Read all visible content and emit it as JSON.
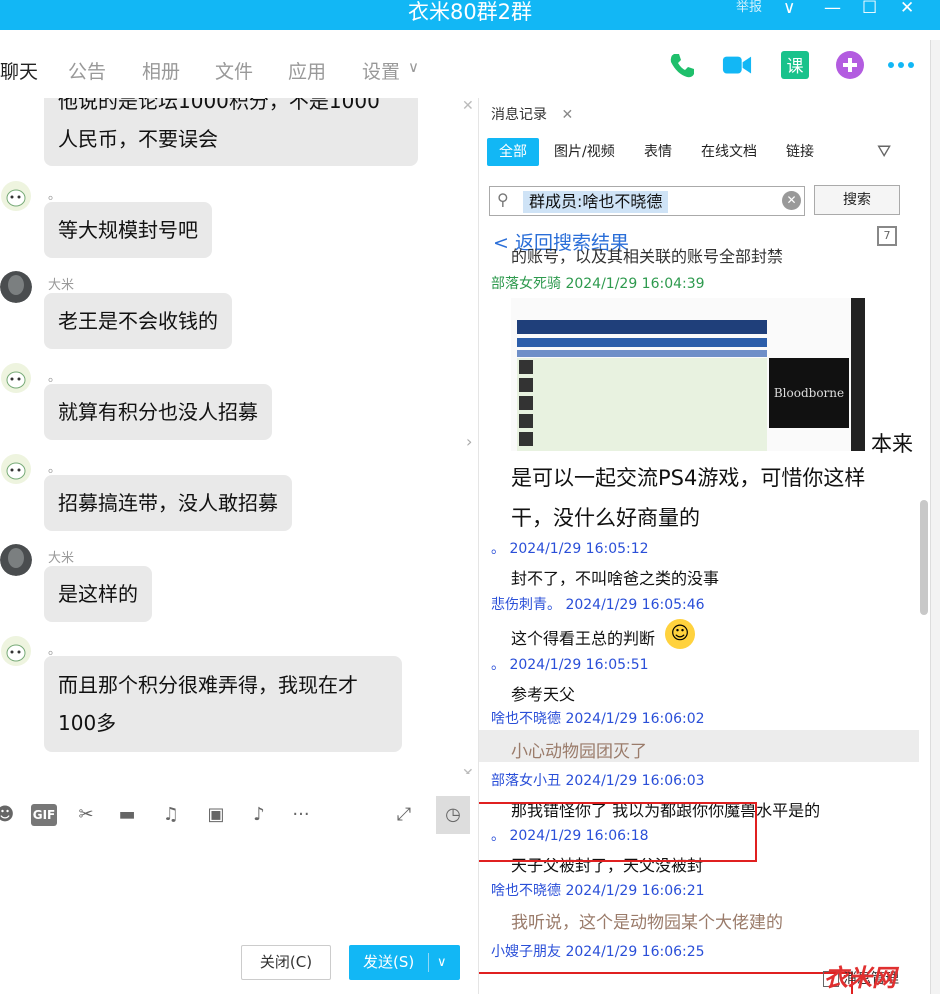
{
  "window": {
    "title": "衣米80群2群",
    "report": "举报"
  },
  "tabs": [
    "聊天",
    "公告",
    "相册",
    "文件",
    "应用",
    "设置"
  ],
  "chat": [
    {
      "nick": "",
      "text_lines": [
        "他说的是论坛1000积分，不是1000",
        "人民币，不要误会"
      ],
      "avatar": "mascot"
    },
    {
      "nick": "。",
      "text_lines": [
        "等大规模封号吧"
      ],
      "avatar": "mascot"
    },
    {
      "nick": "大米",
      "text_lines": [
        "老王是不会收钱的"
      ],
      "avatar": "photo"
    },
    {
      "nick": "。",
      "text_lines": [
        "就算有积分也没人招募"
      ],
      "avatar": "mascot"
    },
    {
      "nick": "。",
      "text_lines": [
        "招募搞连带，没人敢招募"
      ],
      "avatar": "mascot"
    },
    {
      "nick": "大米",
      "text_lines": [
        "是这样的"
      ],
      "avatar": "photo"
    },
    {
      "nick": "。",
      "text_lines": [
        "而且那个积分很难弄得，我现在才",
        "100多"
      ],
      "avatar": "mascot"
    }
  ],
  "composer": {
    "close_label": "关闭(C)",
    "send_label": "发送(S)"
  },
  "history": {
    "tab_label": "消息记录",
    "filters": [
      "全部",
      "图片/视频",
      "表情",
      "在线文档",
      "链接"
    ],
    "search_tag": "群成员:啥也不晓德",
    "search_button": "搜索",
    "back_label": "< 返回搜索结果",
    "partial_top": "的账号，以及其相关联的账号全部封禁",
    "messages": [
      {
        "meta": "部落女死骑 2024/1/29 16:04:39",
        "meta_color": "#2e9a4e",
        "text": ""
      },
      {
        "meta": "。 2024/1/29 16:05:12",
        "meta_color": "#2a4fd8",
        "text": "封不了，不叫啥爸之类的没事"
      },
      {
        "meta": "悲伤刺青。 2024/1/29 16:05:46",
        "meta_color": "#2a4fd8",
        "text": "这个得看王总的判断"
      },
      {
        "meta": "。 2024/1/29 16:05:51",
        "meta_color": "#2a4fd8",
        "text": "参考天父"
      },
      {
        "meta": "啥也不晓德 2024/1/29 16:06:02",
        "meta_color": "#2a4fd8",
        "text": "小心动物园团灭了",
        "highlight": true
      },
      {
        "meta": "部落女小丑 2024/1/29 16:06:03",
        "meta_color": "#2a4fd8",
        "text": "那我错怪你了 我以为都跟你你魔兽水平是的"
      },
      {
        "meta": "。 2024/1/29 16:06:18",
        "meta_color": "#2a4fd8",
        "text": "天子父被封了，天父没被封"
      },
      {
        "meta": "啥也不晓德 2024/1/29 16:06:21",
        "meta_color": "#2a4fd8",
        "text": "我听说，这个是动物园某个大佬建的",
        "highlight": true
      },
      {
        "meta": "小嫂子朋友 2024/1/29 16:06:25",
        "meta_color": "#2a4fd8",
        "text": ""
      }
    ],
    "image_caption_tail": "本来",
    "image_caption_lines": [
      "是可以一起交流PS4游戏，可惜你这样",
      "干，没什么好商量的"
    ],
    "image_brand": "Bloodborne",
    "footer_label": "消息管理",
    "watermark": "衣米网"
  }
}
